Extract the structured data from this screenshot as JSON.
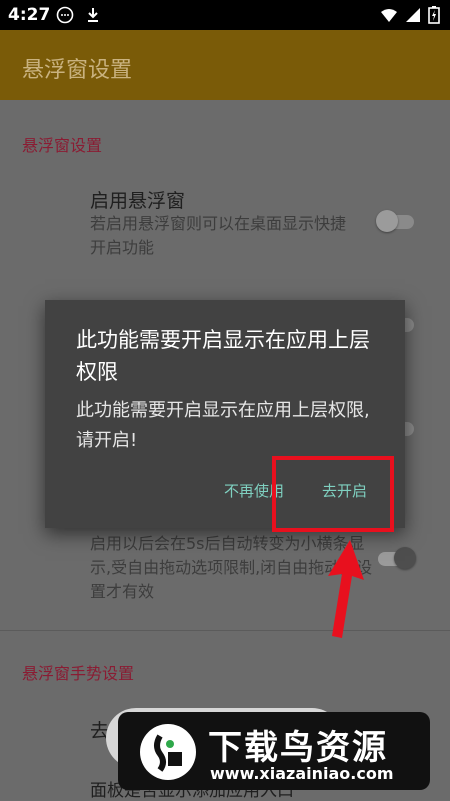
{
  "status_bar": {
    "time": "4:27"
  },
  "app_bar": {
    "title": "悬浮窗设置"
  },
  "sections": {
    "floating": {
      "title": "悬浮窗设置",
      "enable_title": "启用悬浮窗",
      "enable_summary": "若启用悬浮窗则可以在桌面显示快捷开启功能",
      "auto_collapse_summary": "启用以后会在5s后自动转变为小横条显示,受自由拖动选项限制,闭自由拖动此设置才有效"
    },
    "gesture": {
      "title": "悬浮窗手势设置",
      "item1_partial": "去",
      "item2_partial": "面板是否显示添加应用入口"
    }
  },
  "dialog": {
    "title": "此功能需要开启显示在应用上层权限",
    "message": "此功能需要开启显示在应用上层权限,请开启!",
    "btn_never": "不再使用",
    "btn_open": "去开启"
  },
  "watermark": {
    "text": "下载鸟资源",
    "url": "www.xiazainiao.com"
  },
  "colors": {
    "accent": "#8a1c33",
    "button_text": "#7fd0c0",
    "highlight": "#e8101e"
  }
}
